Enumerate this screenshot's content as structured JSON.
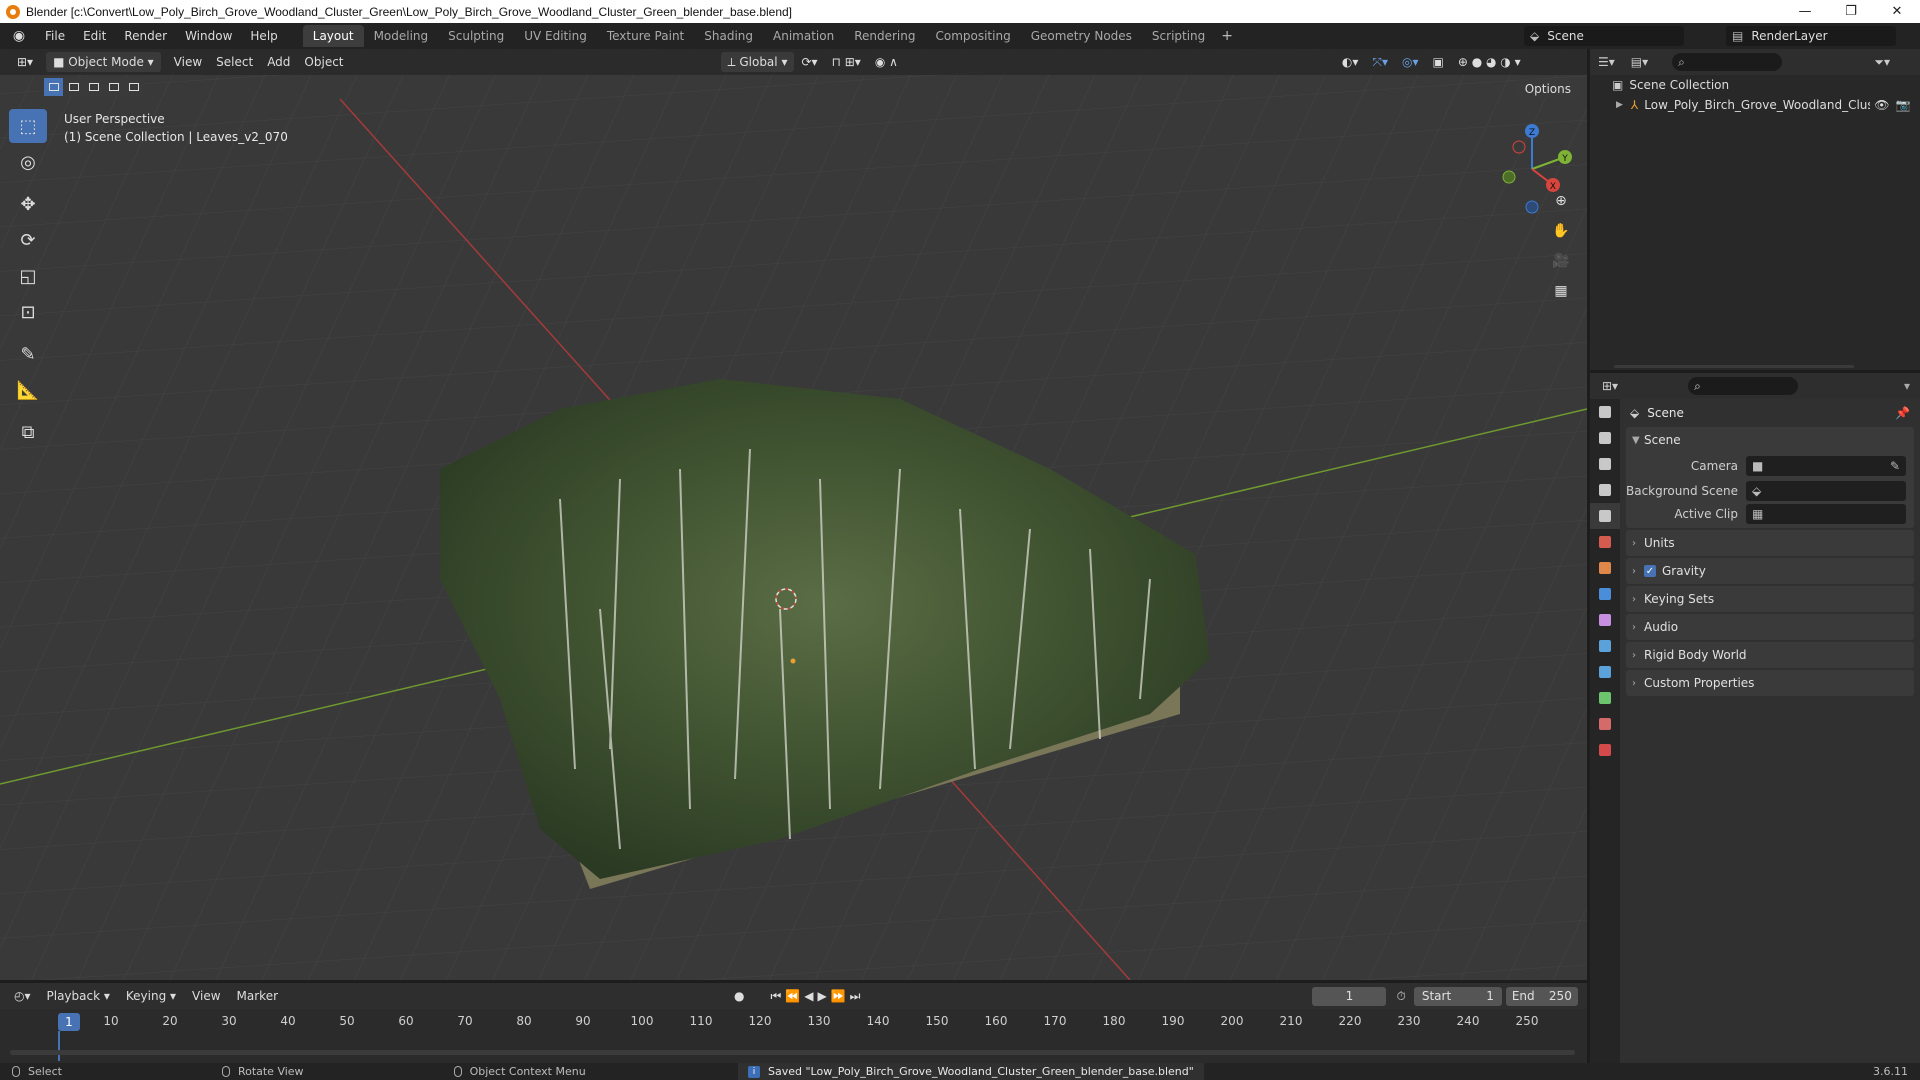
{
  "window": {
    "title": "Blender [c:\\Convert\\Low_Poly_Birch_Grove_Woodland_Cluster_Green\\Low_Poly_Birch_Grove_Woodland_Cluster_Green_blender_base.blend]",
    "minimize": "—",
    "maximize": "❐",
    "close": "✕"
  },
  "menu": [
    "File",
    "Edit",
    "Render",
    "Window",
    "Help"
  ],
  "workspaces": [
    "Layout",
    "Modeling",
    "Sculpting",
    "UV Editing",
    "Texture Paint",
    "Shading",
    "Animation",
    "Rendering",
    "Compositing",
    "Geometry Nodes",
    "Scripting"
  ],
  "active_workspace": "Layout",
  "scene_name": "Scene",
  "view_layer": "RenderLayer",
  "viewport": {
    "mode": "Object Mode",
    "menus": [
      "View",
      "Select",
      "Add",
      "Object"
    ],
    "orientation": "Global",
    "options": "Options",
    "perspective": "User Perspective",
    "collection_info": "(1) Scene Collection | Leaves_v2_070",
    "axes": {
      "x": "X",
      "y": "Y",
      "z": "Z"
    }
  },
  "outliner": {
    "root": "Scene Collection",
    "item": "Low_Poly_Birch_Grove_Woodland_Clust"
  },
  "properties": {
    "header": "Scene",
    "section": "Scene",
    "fields": [
      {
        "label": "Camera",
        "value": ""
      },
      {
        "label": "Background Scene",
        "value": ""
      },
      {
        "label": "Active Clip",
        "value": ""
      }
    ],
    "panels": [
      "Units",
      "Gravity",
      "Keying Sets",
      "Audio",
      "Rigid Body World",
      "Custom Properties"
    ],
    "gravity_checked": true,
    "tab_colors": [
      "#c8c8c8",
      "#c8c8c8",
      "#c8c8c8",
      "#c8c8c8",
      "#c8c8c8",
      "#d45c4e",
      "#e0884a",
      "#4a8ed9",
      "#c88ee0",
      "#5aa2d9",
      "#5aa2d9",
      "#6cc46c",
      "#d46a6a",
      "#d44a4a"
    ]
  },
  "timeline": {
    "menus": [
      "Playback",
      "Keying",
      "View",
      "Marker"
    ],
    "current_frame": "1",
    "start_label": "Start",
    "start": "1",
    "end_label": "End",
    "end": "250",
    "ticks": [
      "10",
      "20",
      "30",
      "40",
      "50",
      "60",
      "70",
      "80",
      "90",
      "100",
      "110",
      "120",
      "130",
      "140",
      "150",
      "160",
      "170",
      "180",
      "190",
      "200",
      "210",
      "220",
      "230",
      "240",
      "250"
    ],
    "playhead": "1"
  },
  "status": {
    "select": "Select",
    "rotate": "Rotate View",
    "context": "Object Context Menu",
    "message": "Saved \"Low_Poly_Birch_Grove_Woodland_Cluster_Green_blender_base.blend\"",
    "version": "3.6.11"
  }
}
